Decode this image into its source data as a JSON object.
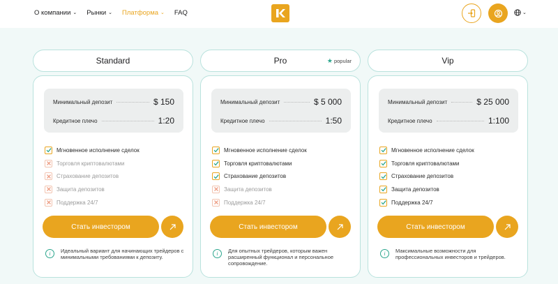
{
  "nav": {
    "items": [
      {
        "label": "О компании",
        "dropdown": true,
        "active": false
      },
      {
        "label": "Рынки",
        "dropdown": true,
        "active": false
      },
      {
        "label": "Платформа",
        "dropdown": true,
        "active": true
      },
      {
        "label": "FAQ",
        "dropdown": false,
        "active": false
      }
    ],
    "logo_letter": "K"
  },
  "header_icons": {
    "login": "login-icon",
    "account": "account-icon",
    "language": "globe-icon"
  },
  "colors": {
    "accent": "#e9a51f",
    "teal": "#2aa58c",
    "border": "#b9e2dd",
    "background": "#f1f9f8"
  },
  "plans": [
    {
      "name": "Standard",
      "popular": null,
      "params": [
        {
          "label": "Минимальный депозит",
          "value": "$ 150"
        },
        {
          "label": "Кредитное плечо",
          "value": "1:20"
        }
      ],
      "features": [
        {
          "label": "Мгновенное исполнение сделок",
          "included": true
        },
        {
          "label": "Торговля криптовалютами",
          "included": false
        },
        {
          "label": "Страхование депозитов",
          "included": false
        },
        {
          "label": "Защита депозитов",
          "included": false
        },
        {
          "label": "Поддержка 24/7",
          "included": false
        }
      ],
      "cta": "Стать инвестором",
      "note": "Идеальный вариант для начинающих трейдеров с минимальными требованиями к депозиту."
    },
    {
      "name": "Pro",
      "popular": "popular",
      "params": [
        {
          "label": "Минимальный депозит",
          "value": "$ 5 000"
        },
        {
          "label": "Кредитное плечо",
          "value": "1:50"
        }
      ],
      "features": [
        {
          "label": "Мгновенное исполнение сделок",
          "included": true
        },
        {
          "label": "Торговля криптовалютами",
          "included": true
        },
        {
          "label": "Страхование депозитов",
          "included": true
        },
        {
          "label": "Защита депозитов",
          "included": false
        },
        {
          "label": "Поддержка 24/7",
          "included": false
        }
      ],
      "cta": "Стать инвестором",
      "note": "Для опытных трейдеров, которым важен расширенный функционал и персональное сопровождение."
    },
    {
      "name": "Vip",
      "popular": null,
      "params": [
        {
          "label": "Минимальный депозит",
          "value": "$ 25 000"
        },
        {
          "label": "Кредитное плечо",
          "value": "1:100"
        }
      ],
      "features": [
        {
          "label": "Мгновенное исполнение сделок",
          "included": true
        },
        {
          "label": "Торговля криптовалютами",
          "included": true
        },
        {
          "label": "Страхование депозитов",
          "included": true
        },
        {
          "label": "Защита депозитов",
          "included": true
        },
        {
          "label": "Поддержка 24/7",
          "included": true
        }
      ],
      "cta": "Стать инвестором",
      "note": "Максимальные возможности для профессиональных инвесторов и трейдеров."
    }
  ]
}
